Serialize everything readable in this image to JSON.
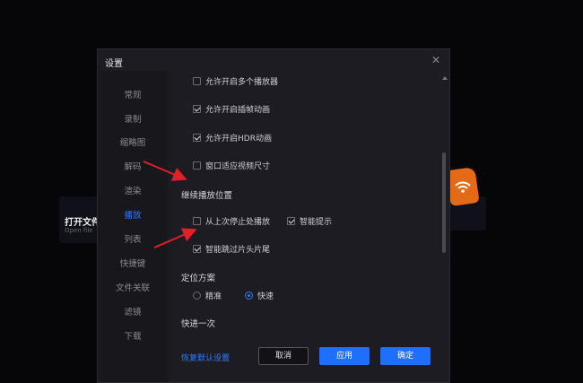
{
  "background": {
    "open_file_label": "打开文件",
    "open_file_sub": "Open file"
  },
  "dialog": {
    "title": "设置",
    "close_icon": "close-icon"
  },
  "sidebar": {
    "items": [
      {
        "label": "常规"
      },
      {
        "label": "录制"
      },
      {
        "label": "缩略图"
      },
      {
        "label": "解码"
      },
      {
        "label": "渲染"
      },
      {
        "label": "播放",
        "active": true
      },
      {
        "label": "列表"
      },
      {
        "label": "快捷键"
      },
      {
        "label": "文件关联"
      },
      {
        "label": "滤镜"
      },
      {
        "label": "下载"
      }
    ]
  },
  "content": {
    "allow_multi_player": {
      "label": "允许开启多个播放器",
      "checked": false
    },
    "allow_frame_anim": {
      "label": "允许开启插帧动画",
      "checked": true
    },
    "allow_hdr_anim": {
      "label": "允许开启HDR动画",
      "checked": true
    },
    "window_fit_video": {
      "label": "窗口适应视频尺寸",
      "checked": false
    },
    "resume_section": "继续播放位置",
    "resume_last_stop": {
      "label": "从上次停止处播放",
      "checked": false
    },
    "smart_prompt": {
      "label": "智能提示",
      "checked": true
    },
    "smart_skip": {
      "label": "智能跳过片头片尾",
      "checked": true
    },
    "seek_section": "定位方案",
    "seek_precise": {
      "label": "精准",
      "checked": false
    },
    "seek_fast": {
      "label": "快速",
      "checked": true
    },
    "fast_forward_section": "快进一次"
  },
  "footer": {
    "restore_default": "恢复默认设置",
    "cancel": "取消",
    "apply": "应用",
    "ok": "确定"
  },
  "colors": {
    "accent": "#2d7cff",
    "annotation_arrow": "#e0202a",
    "dialog_bg": "#1c1c22"
  }
}
